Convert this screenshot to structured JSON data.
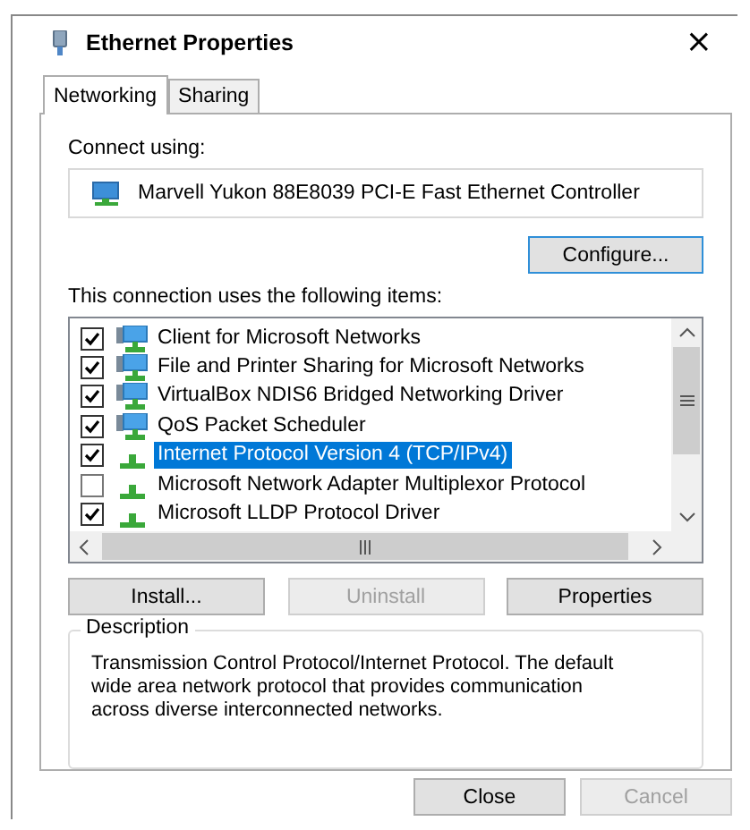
{
  "window": {
    "title": "Ethernet Properties",
    "close": "×"
  },
  "tabs": [
    {
      "label": "Networking",
      "selected": true
    },
    {
      "label": "Sharing",
      "selected": false
    }
  ],
  "connect_using": {
    "label": "Connect using:",
    "adapter": "Marvell Yukon 88E8039 PCI-E Fast Ethernet Controller",
    "configure": "Configure..."
  },
  "items_label": "This connection uses the following items:",
  "items": [
    {
      "label": "Client for Microsoft Networks",
      "kind": "service",
      "checked": true,
      "selected": false
    },
    {
      "label": "File and Printer Sharing for Microsoft Networks",
      "kind": "service",
      "checked": true,
      "selected": false
    },
    {
      "label": "VirtualBox NDIS6 Bridged Networking Driver",
      "kind": "service",
      "checked": true,
      "selected": false
    },
    {
      "label": "QoS Packet Scheduler",
      "kind": "service",
      "checked": true,
      "selected": false
    },
    {
      "label": "Internet Protocol Version 4 (TCP/IPv4)",
      "kind": "protocol",
      "checked": true,
      "selected": true
    },
    {
      "label": "Microsoft Network Adapter Multiplexor Protocol",
      "kind": "protocol",
      "checked": false,
      "selected": false
    },
    {
      "label": "Microsoft LLDP Protocol Driver",
      "kind": "protocol",
      "checked": true,
      "selected": false
    }
  ],
  "item_buttons": [
    {
      "label": "Install...",
      "disabled": false
    },
    {
      "label": "Uninstall",
      "disabled": true
    },
    {
      "label": "Properties",
      "disabled": false
    }
  ],
  "description": {
    "title": "Description",
    "text": "Transmission Control Protocol/Internet Protocol. The default wide area network protocol that provides communication across diverse interconnected networks."
  },
  "footer_buttons": [
    {
      "label": "Close",
      "disabled": false
    },
    {
      "label": "Cancel",
      "disabled": true
    }
  ]
}
